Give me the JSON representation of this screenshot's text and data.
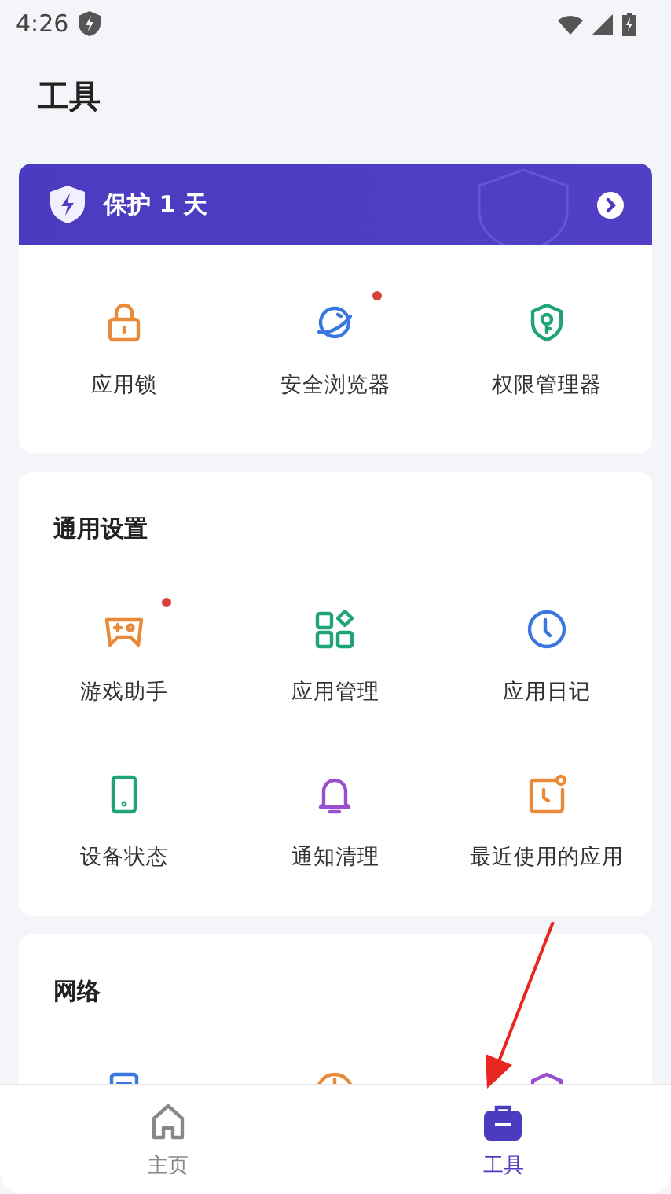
{
  "status_bar": {
    "time": "4:26"
  },
  "title": "工具",
  "protection_card": {
    "banner": "保护 1 天",
    "items": [
      {
        "label": "应用锁",
        "dot": false
      },
      {
        "label": "安全浏览器",
        "dot": true
      },
      {
        "label": "权限管理器",
        "dot": false
      }
    ]
  },
  "sections": [
    {
      "title": "通用设置",
      "items": [
        {
          "label": "游戏助手",
          "dot": true
        },
        {
          "label": "应用管理",
          "dot": false
        },
        {
          "label": "应用日记",
          "dot": false
        },
        {
          "label": "设备状态",
          "dot": false
        },
        {
          "label": "通知清理",
          "dot": false
        },
        {
          "label": "最近使用的应用",
          "dot": false
        }
      ]
    },
    {
      "title": "网络"
    }
  ],
  "bottom_nav": [
    {
      "label": "主页",
      "selected": false
    },
    {
      "label": "工具",
      "selected": true
    }
  ]
}
